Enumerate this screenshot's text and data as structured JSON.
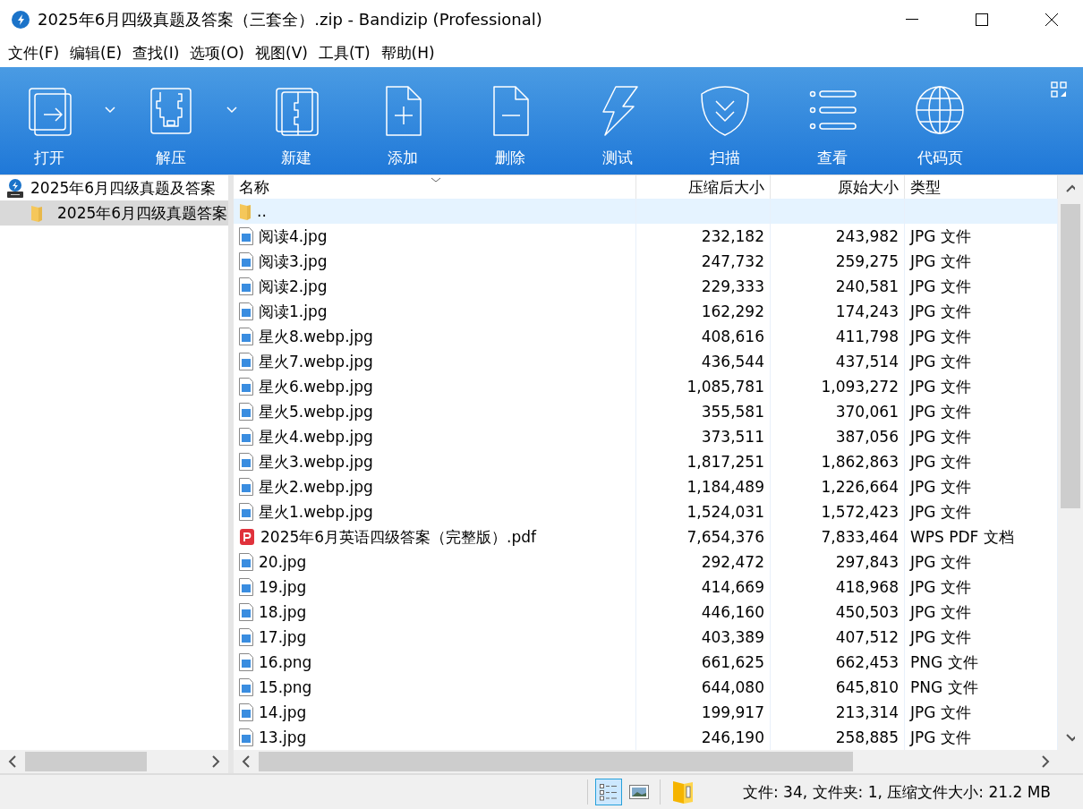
{
  "window": {
    "title": "2025年6月四级真题及答案（三套全）.zip - Bandizip (Professional)"
  },
  "menu": [
    "文件(F)",
    "编辑(E)",
    "查找(I)",
    "选项(O)",
    "视图(V)",
    "工具(T)",
    "帮助(H)"
  ],
  "toolbar": [
    {
      "kind": "open",
      "label": "打开",
      "dropdown": true
    },
    {
      "kind": "extract",
      "label": "解压",
      "dropdown": true
    },
    {
      "kind": "new",
      "label": "新建",
      "dropdown": false
    },
    {
      "kind": "add",
      "label": "添加",
      "dropdown": false
    },
    {
      "kind": "delete",
      "label": "删除",
      "dropdown": false
    },
    {
      "kind": "test",
      "label": "测试",
      "dropdown": false
    },
    {
      "kind": "scan",
      "label": "扫描",
      "dropdown": false
    },
    {
      "kind": "view",
      "label": "查看",
      "dropdown": false
    },
    {
      "kind": "codepage",
      "label": "代码页",
      "dropdown": false
    }
  ],
  "tree": [
    {
      "label": "2025年6月四级真题及答案",
      "selected": false,
      "children": [
        {
          "label": "2025年6月四级真题答案",
          "selected": true
        }
      ]
    }
  ],
  "table": {
    "columns": [
      "名称",
      "压缩后大小",
      "原始大小",
      "类型"
    ],
    "rows": [
      {
        "kind": "folder",
        "name": "..",
        "packed": "",
        "size": "",
        "type": "",
        "selected": true
      },
      {
        "kind": "image",
        "name": "阅读4.jpg",
        "packed": "232,182",
        "size": "243,982",
        "type": "JPG 文件",
        "selected": false
      },
      {
        "kind": "image",
        "name": "阅读3.jpg",
        "packed": "247,732",
        "size": "259,275",
        "type": "JPG 文件",
        "selected": false
      },
      {
        "kind": "image",
        "name": "阅读2.jpg",
        "packed": "229,333",
        "size": "240,581",
        "type": "JPG 文件",
        "selected": false
      },
      {
        "kind": "image",
        "name": "阅读1.jpg",
        "packed": "162,292",
        "size": "174,243",
        "type": "JPG 文件",
        "selected": false
      },
      {
        "kind": "image",
        "name": "星火8.webp.jpg",
        "packed": "408,616",
        "size": "411,798",
        "type": "JPG 文件",
        "selected": false
      },
      {
        "kind": "image",
        "name": "星火7.webp.jpg",
        "packed": "436,544",
        "size": "437,514",
        "type": "JPG 文件",
        "selected": false
      },
      {
        "kind": "image",
        "name": "星火6.webp.jpg",
        "packed": "1,085,781",
        "size": "1,093,272",
        "type": "JPG 文件",
        "selected": false
      },
      {
        "kind": "image",
        "name": "星火5.webp.jpg",
        "packed": "355,581",
        "size": "370,061",
        "type": "JPG 文件",
        "selected": false
      },
      {
        "kind": "image",
        "name": "星火4.webp.jpg",
        "packed": "373,511",
        "size": "387,056",
        "type": "JPG 文件",
        "selected": false
      },
      {
        "kind": "image",
        "name": "星火3.webp.jpg",
        "packed": "1,817,251",
        "size": "1,862,863",
        "type": "JPG 文件",
        "selected": false
      },
      {
        "kind": "image",
        "name": "星火2.webp.jpg",
        "packed": "1,184,489",
        "size": "1,226,664",
        "type": "JPG 文件",
        "selected": false
      },
      {
        "kind": "image",
        "name": "星火1.webp.jpg",
        "packed": "1,524,031",
        "size": "1,572,423",
        "type": "JPG 文件",
        "selected": false
      },
      {
        "kind": "pdf",
        "name": "2025年6月英语四级答案（完整版）.pdf",
        "packed": "7,654,376",
        "size": "7,833,464",
        "type": "WPS PDF 文档",
        "selected": false
      },
      {
        "kind": "image",
        "name": "20.jpg",
        "packed": "292,472",
        "size": "297,843",
        "type": "JPG 文件",
        "selected": false
      },
      {
        "kind": "image",
        "name": "19.jpg",
        "packed": "414,669",
        "size": "418,968",
        "type": "JPG 文件",
        "selected": false
      },
      {
        "kind": "image",
        "name": "18.jpg",
        "packed": "446,160",
        "size": "450,503",
        "type": "JPG 文件",
        "selected": false
      },
      {
        "kind": "image",
        "name": "17.jpg",
        "packed": "403,389",
        "size": "407,512",
        "type": "JPG 文件",
        "selected": false
      },
      {
        "kind": "image",
        "name": "16.png",
        "packed": "661,625",
        "size": "662,453",
        "type": "PNG 文件",
        "selected": false
      },
      {
        "kind": "image",
        "name": "15.png",
        "packed": "644,080",
        "size": "645,810",
        "type": "PNG 文件",
        "selected": false
      },
      {
        "kind": "image",
        "name": "14.jpg",
        "packed": "199,917",
        "size": "213,314",
        "type": "JPG 文件",
        "selected": false
      },
      {
        "kind": "image",
        "name": "13.jpg",
        "packed": "246,190",
        "size": "258,885",
        "type": "JPG 文件",
        "selected": false
      }
    ]
  },
  "status_bar": {
    "text": "文件: 34, 文件夹: 1, 压缩文件大小: 21.2 MB",
    "view_buttons": [
      {
        "kind": "details",
        "selected": true
      },
      {
        "kind": "thumbnails",
        "selected": false
      }
    ]
  }
}
